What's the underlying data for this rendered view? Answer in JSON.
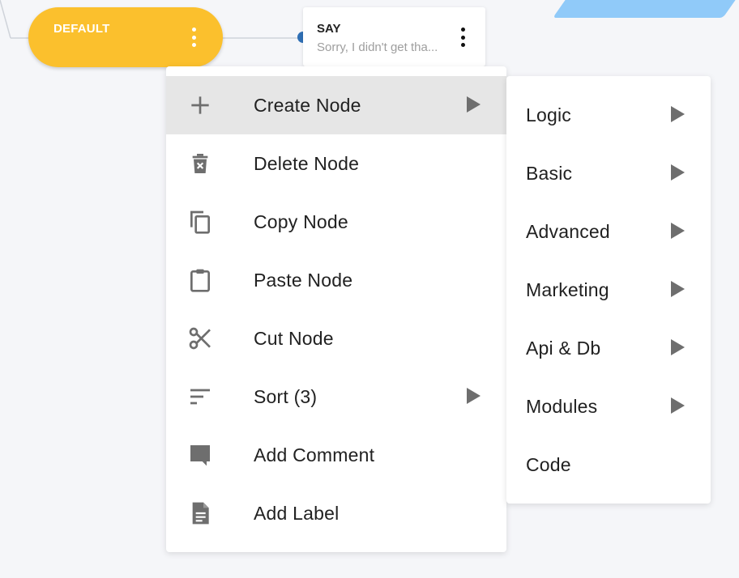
{
  "canvas": {
    "default_node": {
      "label": "DEFAULT"
    },
    "say_node": {
      "title": "SAY",
      "subtitle": "Sorry, I didn't get tha..."
    }
  },
  "context_menu": {
    "items": [
      {
        "label": "Create Node",
        "icon": "plus-icon",
        "has_submenu": true,
        "active": true
      },
      {
        "label": "Delete Node",
        "icon": "trash-icon",
        "has_submenu": false
      },
      {
        "label": "Copy Node",
        "icon": "copy-icon",
        "has_submenu": false
      },
      {
        "label": "Paste Node",
        "icon": "clipboard-icon",
        "has_submenu": false
      },
      {
        "label": "Cut Node",
        "icon": "scissors-icon",
        "has_submenu": false
      },
      {
        "label": "Sort (3)",
        "icon": "sort-icon",
        "has_submenu": true
      },
      {
        "label": "Add Comment",
        "icon": "comment-icon",
        "has_submenu": false
      },
      {
        "label": "Add Label",
        "icon": "document-icon",
        "has_submenu": false
      }
    ]
  },
  "submenu": {
    "items": [
      {
        "label": "Logic",
        "has_submenu": true
      },
      {
        "label": "Basic",
        "has_submenu": true
      },
      {
        "label": "Advanced",
        "has_submenu": true
      },
      {
        "label": "Marketing",
        "has_submenu": true
      },
      {
        "label": "Api & Db",
        "has_submenu": true
      },
      {
        "label": "Modules",
        "has_submenu": true
      },
      {
        "label": "Code",
        "has_submenu": false
      }
    ]
  },
  "colors": {
    "canvas_bg": "#f5f6f9",
    "default_node": "#fbc02d",
    "port": "#2f6fb5",
    "accent_shape": "#90caf9",
    "icon": "#6e6e6e",
    "active_row": "#e6e6e6"
  }
}
